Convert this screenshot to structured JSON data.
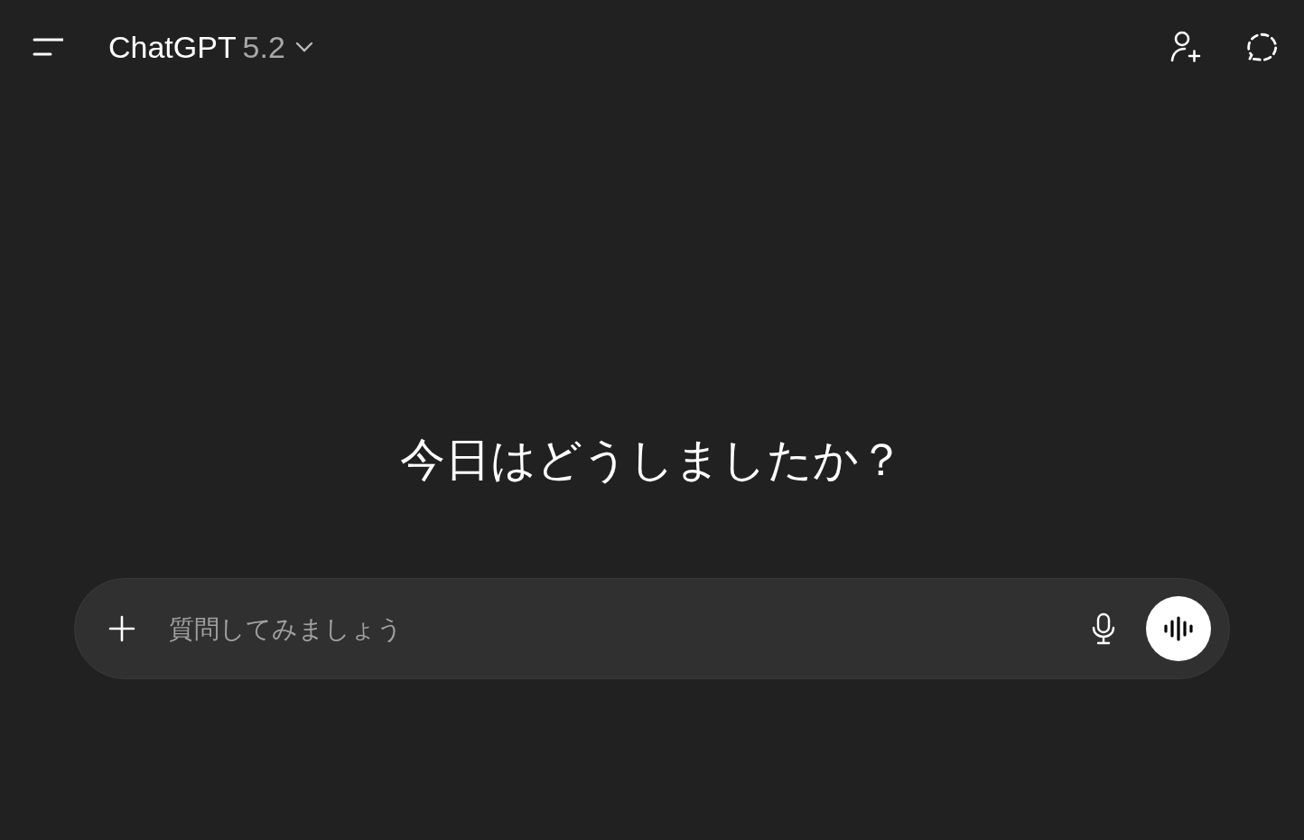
{
  "header": {
    "title": "ChatGPT",
    "version": "5.2"
  },
  "greeting": "今日はどうしましたか？",
  "composer": {
    "placeholder": "質問してみましょう"
  }
}
